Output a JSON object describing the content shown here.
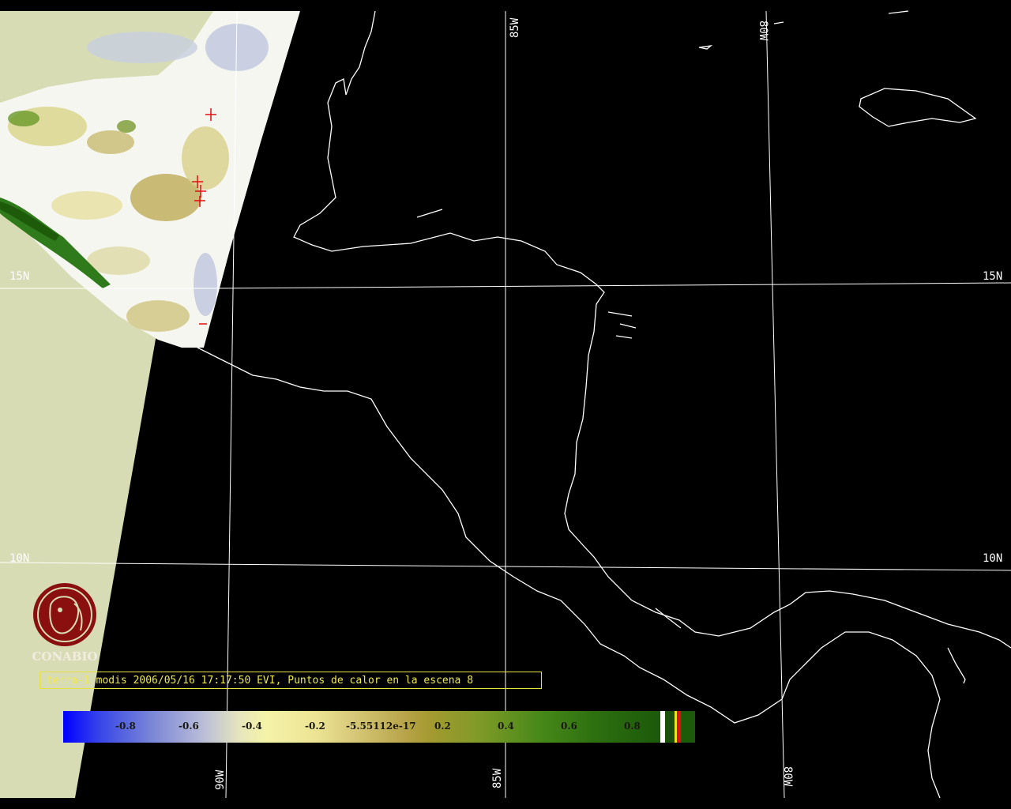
{
  "map": {
    "lon_labels_top": [
      "85W",
      "80W"
    ],
    "lon_labels_bottom": [
      "90W",
      "85W",
      "80W"
    ],
    "lat_labels_left": [
      "15N",
      "10N"
    ],
    "lat_labels_right": [
      "15N",
      "10N"
    ]
  },
  "caption": "terra-1 modis 2006/05/16 17:17:50 EVI, Puntos de calor en la escena 8",
  "colorbar": {
    "ticks": [
      "-0.8",
      "-0.6",
      "-0.4",
      "-0.2",
      "-5.55112e-17",
      "0.2",
      "0.4",
      "0.6",
      "0.8"
    ],
    "colors": {
      "low": "#0000ff",
      "mid": "#f5f3a8",
      "high": "#1d5a0a",
      "hotspot": "#e01010"
    }
  },
  "logo": {
    "text": "CONABIO",
    "color": "#8a1010"
  },
  "colors": {
    "background": "#000000",
    "land_outside_swath": "#d8dcb4",
    "coastline": "#ffffff",
    "grid": "#ffffff"
  }
}
